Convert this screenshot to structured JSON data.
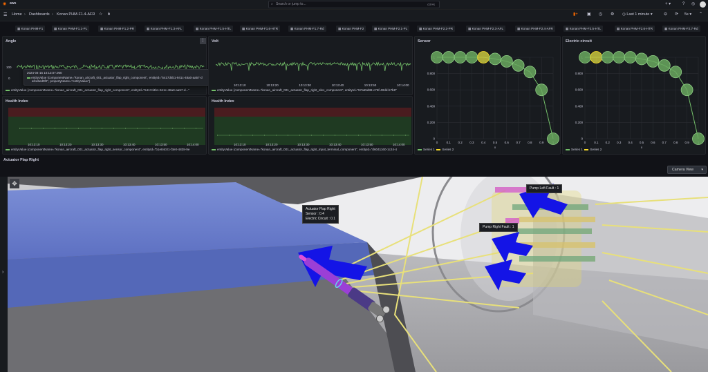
{
  "search": {
    "placeholder": "Search or jump to...",
    "shortcut": "ctrl+k"
  },
  "breadcrumb": {
    "home": "Home",
    "dashboards": "Dashboards",
    "current": "Konan PHM-F1.4-AFR"
  },
  "time_picker": {
    "label": "Last 1 minute",
    "refresh": "5s"
  },
  "dashboard_links": [
    "Konan PHM-F1",
    "Konan PHM-F1.1-PL",
    "Konan PHM-F1.2-PR",
    "Konan PHM-F1.3-AFL",
    "Konan PHM-F1.5-HTL",
    "Konan PHM-F1.6-HTR",
    "Konan PHM-F1.7-Rd",
    "Konan PHM-F2",
    "Konan PHM-F2.1-PL",
    "Konan PHM-F2.2-PR",
    "Konan PHM-F2.3-AFL",
    "Konan PHM-F2.4-AFR",
    "Konan PHM-F2.5-HTL",
    "Konan PHM-F2.6-HTR",
    "Konan PHM-F2.7-Rd"
  ],
  "panels": {
    "angle": {
      "title": "Angle",
      "ytick_top": "100",
      "ytick_bottom": "0",
      "legend": "entityValue {componentName=\"konan_aircraft_001_actuator_flap_right_component\", entityId=\"5417d4b1-941c-48a0-aa57-d...\""
    },
    "volt": {
      "title": "Volt",
      "legend": "entityValue {componentName=\"konan_aircraft_001_actuator_flap_right_elec_component\", entityId=\"57a55d88-c76f-40dd-b7b8\""
    },
    "health_left": {
      "title": "Health Index",
      "legend": "entityValue {componentName=\"konan_aircraft_001_actuator_flap_right_sensor_component\", entityId=\"b1e84c01-f3e0-4838-9e"
    },
    "health_right": {
      "title": "Health Index",
      "legend": "entityValue {componentName=\"konan_aircraft_001_actuator_flap_right_input_terminal_component\", entityId=\"d6041160-1c24-4"
    },
    "sensor": {
      "title": "Sensor",
      "legend1": "Series 1",
      "legend2": "Series 2",
      "xlabel": "x"
    },
    "electric": {
      "title": "Electric circuit",
      "legend1": "Series 1",
      "legend2": "Series 2",
      "xlabel": "x"
    }
  },
  "time_ticks": [
    "10:13:10",
    "10:13:20",
    "10:13:30",
    "10:13:40",
    "10:13:50",
    "10:14:00"
  ],
  "tooltip": {
    "time": "2024-04-15 10:13:07.060",
    "series": "entityValue {componentName=\"konan_aircraft_001_actuator_flap_right_component\", entityId=\"5417d4b1-941c-48a0-aa57-d",
    "series_cont": "afcebed0f2\", propertyName=\"entityValue\"}",
    "value": "52.7"
  },
  "scene": {
    "title": "Actuator Flap Right",
    "camera_label": "Camera View",
    "label_actuator": {
      "name": "Actuator Flap Right",
      "sensor": "Sensor : 0.4",
      "circuit": "Electric Circuit : 0.1"
    },
    "label_pump_left": "Pump Left Fault : 1",
    "label_pump_right": "Pump Right Fault : 1"
  },
  "chart_data": [
    {
      "type": "scatter",
      "title": "Sensor",
      "xlabel": "x",
      "x": [
        0,
        0.1,
        0.2,
        0.3,
        0.4,
        0.5,
        0.6,
        0.7,
        0.8,
        0.9,
        1
      ],
      "y": [
        1,
        1,
        1,
        1,
        1,
        0.98,
        0.95,
        0.9,
        0.82,
        0.6,
        0
      ],
      "highlight_index": 4,
      "ylim": [
        0,
        1
      ],
      "xlim": [
        0,
        1
      ],
      "yticks": [
        "0",
        "0.200",
        "0.400",
        "0.600",
        "0.800",
        "1"
      ],
      "xticks": [
        "0",
        "0.1",
        "0.2",
        "0.3",
        "0.4",
        "0.5",
        "0.6",
        "0.7",
        "0.8",
        "0.9",
        "1"
      ],
      "series": [
        {
          "name": "Series 1",
          "color": "#73bf69"
        },
        {
          "name": "Series 2",
          "color": "#fade2a"
        }
      ]
    },
    {
      "type": "scatter",
      "title": "Electric circuit",
      "xlabel": "x",
      "x": [
        0,
        0.1,
        0.2,
        0.3,
        0.4,
        0.5,
        0.6,
        0.7,
        0.8,
        0.9,
        1
      ],
      "y": [
        1,
        1,
        1,
        1,
        1,
        0.98,
        0.95,
        0.9,
        0.82,
        0.6,
        0
      ],
      "highlight_index": 1,
      "ylim": [
        0,
        1
      ],
      "xlim": [
        0,
        1
      ],
      "yticks": [
        "0",
        "0.200",
        "0.400",
        "0.600",
        "0.800",
        "1"
      ],
      "xticks": [
        "0",
        "0.1",
        "0.2",
        "0.3",
        "0.4",
        "0.5",
        "0.6",
        "0.7",
        "0.8",
        "0.9",
        "1"
      ],
      "series": [
        {
          "name": "Series 1",
          "color": "#73bf69"
        },
        {
          "name": "Series 2",
          "color": "#fade2a"
        }
      ]
    }
  ],
  "colors": {
    "green": "#73bf69",
    "yellow": "#fade2a",
    "panel": "#181b1f",
    "bg": "#111217",
    "red_band": "#4a1c1f",
    "green_band": "#1f3a22"
  }
}
